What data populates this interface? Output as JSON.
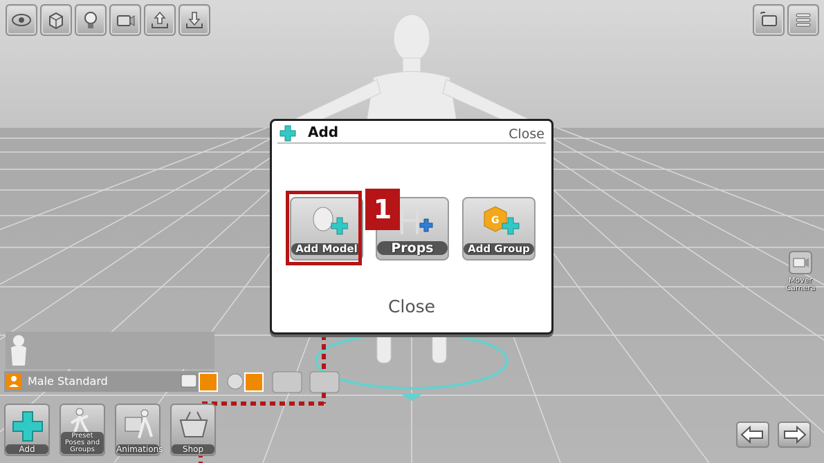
{
  "dialog": {
    "title": "Add",
    "close_top": "Close",
    "close_bottom": "Close",
    "options": [
      {
        "label": "Add Model",
        "icon": "add-model-icon"
      },
      {
        "label": "Props",
        "icon": "props-chair-icon"
      },
      {
        "label": "Add Group",
        "icon": "add-group-icon"
      }
    ]
  },
  "callout": {
    "number": "1",
    "color": "#b51516"
  },
  "model_bar": {
    "name": "Male Standard"
  },
  "bottom_toolbar": [
    {
      "label": "Add"
    },
    {
      "label": "Preset Poses and Groups"
    },
    {
      "label": "Animations"
    },
    {
      "label": "Shop"
    }
  ],
  "mover_camera": {
    "line1": "Mover",
    "line2": "Camera"
  },
  "top_toolbar_icons": [
    "eye-icon",
    "cube-icon",
    "light-bulb-icon",
    "camera-icon",
    "import-icon",
    "export-icon"
  ],
  "colors": {
    "accent": "#31c9c6",
    "orange": "#ef8a00",
    "highlight": "#b51516"
  }
}
